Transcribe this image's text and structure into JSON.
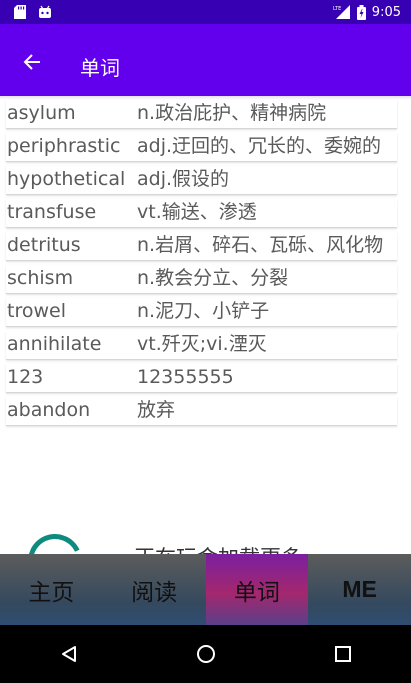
{
  "status_bar": {
    "time": "9:05",
    "network": "LTE"
  },
  "app_bar": {
    "title": "单词"
  },
  "words": [
    {
      "word": "asylum",
      "meaning": "n.政治庇护、精神病院"
    },
    {
      "word": "periphrastic",
      "meaning": "adj.迂回的、冗长的、委婉的"
    },
    {
      "word": "hypothetical",
      "meaning": "adj.假设的"
    },
    {
      "word": "transfuse",
      "meaning": "vt.输送、渗透"
    },
    {
      "word": "detritus",
      "meaning": "n.岩屑、碎石、瓦砾、风化物"
    },
    {
      "word": "schism",
      "meaning": "n.教会分立、分裂"
    },
    {
      "word": "trowel",
      "meaning": "n.泥刀、小铲子"
    },
    {
      "word": "annihilate",
      "meaning": "vt.歼灭;vi.湮灭"
    },
    {
      "word": "123",
      "meaning": "12355555"
    },
    {
      "word": "abandon",
      "meaning": "放弃"
    }
  ],
  "loading": {
    "text": "正在玩命加载更多"
  },
  "bottom_nav": [
    {
      "label": "主页"
    },
    {
      "label": "阅读"
    },
    {
      "label": "单词"
    },
    {
      "label": "ME"
    }
  ],
  "colors": {
    "status_bar": "#3700b3",
    "app_bar": "#6200ee",
    "spinner": "#0d8b7f",
    "active_tab": "#a4276d"
  }
}
